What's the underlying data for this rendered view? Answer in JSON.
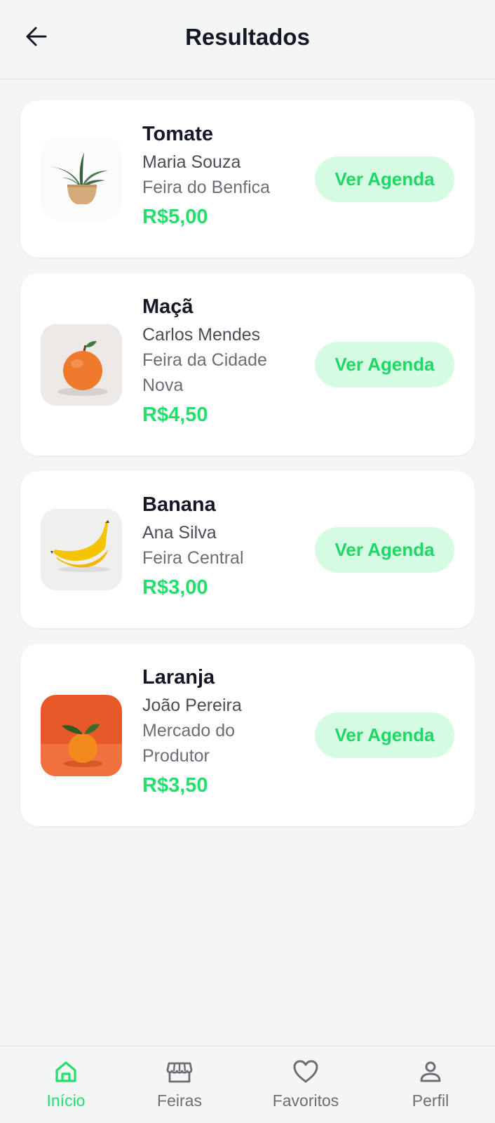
{
  "header": {
    "title": "Resultados",
    "back_icon": "arrow-left-icon"
  },
  "colors": {
    "accent": "#22e06b",
    "button_bg": "#d6fbe3",
    "text_dark": "#141826",
    "text_muted": "#6b6e76"
  },
  "results": [
    {
      "name": "Tomate",
      "seller": "Maria Souza",
      "market": "Feira do Benfica",
      "price": "R$5,00",
      "button": "Ver Agenda",
      "image": "potted-plant-image"
    },
    {
      "name": "Maçã",
      "seller": "Carlos Mendes",
      "market": "Feira da Cidade Nova",
      "price": "R$4,50",
      "button": "Ver Agenda",
      "image": "orange-fruit-image"
    },
    {
      "name": "Banana",
      "seller": "Ana Silva",
      "market": "Feira Central",
      "price": "R$3,00",
      "button": "Ver Agenda",
      "image": "banana-image"
    },
    {
      "name": "Laranja",
      "seller": "João Pereira",
      "market": "Mercado do Produtor",
      "price": "R$3,50",
      "button": "Ver Agenda",
      "image": "orange-on-orange-image"
    }
  ],
  "nav": [
    {
      "label": "Início",
      "icon": "home-icon",
      "active": true
    },
    {
      "label": "Feiras",
      "icon": "store-icon",
      "active": false
    },
    {
      "label": "Favoritos",
      "icon": "heart-icon",
      "active": false
    },
    {
      "label": "Perfil",
      "icon": "user-icon",
      "active": false
    }
  ]
}
